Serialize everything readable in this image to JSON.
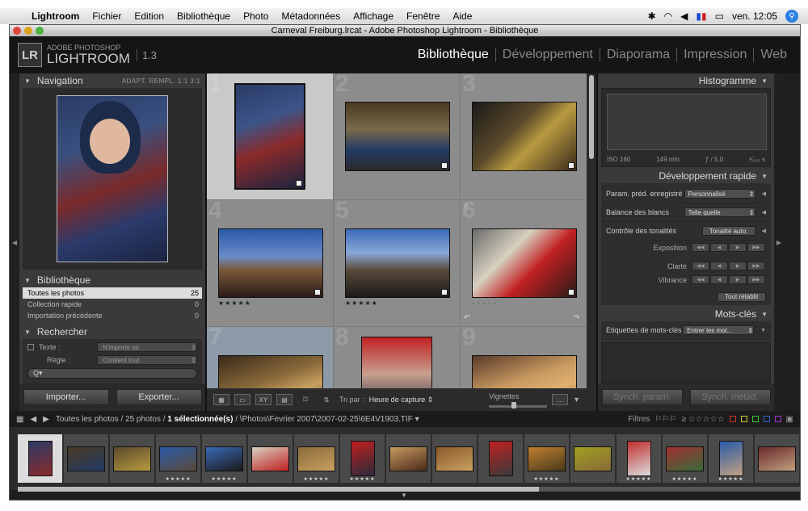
{
  "menubar": {
    "app": "Lightroom",
    "items": [
      "Fichier",
      "Edition",
      "Bibliothèque",
      "Photo",
      "Métadonnées",
      "Affichage",
      "Fenêtre",
      "Aide"
    ],
    "clock": "ven. 12:05"
  },
  "window": {
    "title": "Carneval Freiburg.lrcat - Adobe Photoshop Lightroom - Bibliothèque"
  },
  "header": {
    "logo": "LR",
    "brand_top": "ADOBE PHOTOSHOP",
    "brand": "LIGHTROOM",
    "version": "1.3",
    "modules": [
      "Bibliothèque",
      "Développement",
      "Diaporama",
      "Impression",
      "Web"
    ],
    "active_module": "Bibliothèque"
  },
  "navigation": {
    "title": "Navigation",
    "zoom": "ADAPT.  REMPL.  1:1  3:1"
  },
  "library": {
    "title": "Bibliothèque",
    "items": [
      {
        "label": "Toutes les photos",
        "count": "25"
      },
      {
        "label": "Collection rapide",
        "count": "0"
      },
      {
        "label": "Importation précédente",
        "count": "0"
      }
    ]
  },
  "search": {
    "title": "Rechercher",
    "text_label": "Texte :",
    "text_value": "N'importe où",
    "rule_label": "Règle :",
    "rule_value": "Contient tout",
    "input_placeholder": "Q▾"
  },
  "left_buttons": {
    "import": "Importer...",
    "export": "Exporter..."
  },
  "grid": {
    "cells": [
      {
        "num": "1",
        "stars": ""
      },
      {
        "num": "2",
        "stars": ""
      },
      {
        "num": "3",
        "stars": ""
      },
      {
        "num": "4",
        "stars": "★★★★★"
      },
      {
        "num": "5",
        "stars": "★★★★★"
      },
      {
        "num": "6",
        "stars": "· · · · ·"
      },
      {
        "num": "7",
        "stars": ""
      },
      {
        "num": "8",
        "stars": ""
      },
      {
        "num": "9",
        "stars": ""
      }
    ]
  },
  "toolbar": {
    "sort_label": "Tri par :",
    "sort_value": "Heure de capture",
    "thumbs_label": "Vignettes"
  },
  "histogram": {
    "title": "Histogramme",
    "iso": "ISO 160",
    "focal": "149 mm",
    "aperture": "ƒ / 5,0",
    "shutter": "¹⁄₂₀₀ s"
  },
  "quick_develop": {
    "title": "Développement rapide",
    "preset_label": "Param. préd. enregistré",
    "preset_value": "Personnalisé",
    "wb_label": "Balance des blancs",
    "wb_value": "Telle quelle",
    "tone_label": "Contrôle des tonalités",
    "tone_button": "Tonalité auto.",
    "exposure": "Exposition",
    "clarity": "Clarté",
    "vibrance": "Vibrance",
    "reset": "Tout rétablir"
  },
  "keywords": {
    "title": "Mots-clés",
    "label": "Etiquettes de mots-clés",
    "value": "Entrer les mot..."
  },
  "right_buttons": {
    "sync_param": "Synch. param.",
    "sync_meta": "Synch. métad."
  },
  "filmstrip_bar": {
    "path_prefix": "Toutes les photos / 25 photos / ",
    "selected": "1 sélectionnée(s)",
    "path_suffix": " / \\Photos\\Fevrier 2007\\2007-02-25\\6E4V1903.TIF ▾",
    "filters": "Filtres",
    "rating_filter": "≥ ☆☆☆☆☆"
  },
  "filmstrip": {
    "stars": [
      "",
      "",
      "",
      "★★★★★",
      "★★★★★",
      "",
      "★★★★★",
      "★★★★★",
      "",
      "",
      "",
      "★★★★★",
      "",
      "★★★★★",
      "★★★★★",
      "★★★★★",
      "",
      "",
      ""
    ]
  },
  "colors": {
    "accent": "#2a80e0",
    "selected_cell": "#c9c9c9",
    "panel": "#3a3a3a"
  }
}
